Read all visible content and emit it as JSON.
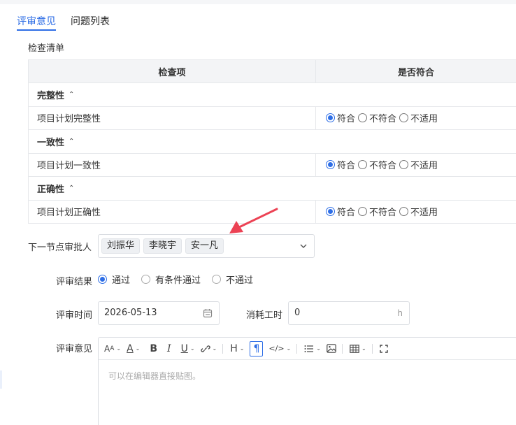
{
  "tabs": [
    {
      "label": "评审意见",
      "active": true
    },
    {
      "label": "问题列表",
      "active": false
    }
  ],
  "checklist": {
    "title": "检查清单",
    "columns": [
      "检查项",
      "是否符合"
    ],
    "options": [
      "符合",
      "不符合",
      "不适用"
    ],
    "groups": [
      {
        "name": "完整性",
        "items": [
          {
            "label": "项目计划完整性",
            "selected": "符合"
          }
        ]
      },
      {
        "name": "一致性",
        "items": [
          {
            "label": "项目计划一致性",
            "selected": "符合"
          }
        ]
      },
      {
        "name": "正确性",
        "items": [
          {
            "label": "项目计划正确性",
            "selected": "符合"
          }
        ]
      }
    ]
  },
  "approver": {
    "label": "下一节点审批人",
    "tags": [
      "刘振华",
      "李晓宇",
      "安一凡"
    ]
  },
  "result": {
    "label": "评审结果",
    "options": [
      "通过",
      "有条件通过",
      "不通过"
    ],
    "selected": "通过"
  },
  "review_time": {
    "label": "评审时间",
    "value": "2026-05-13"
  },
  "hours": {
    "label": "消耗工时",
    "value": "0",
    "unit": "h"
  },
  "opinion": {
    "label": "评审意见",
    "placeholder": "可以在编辑器直接贴图。"
  },
  "colors": {
    "accent": "#2e6ee6",
    "annotation": "#ec4254"
  }
}
